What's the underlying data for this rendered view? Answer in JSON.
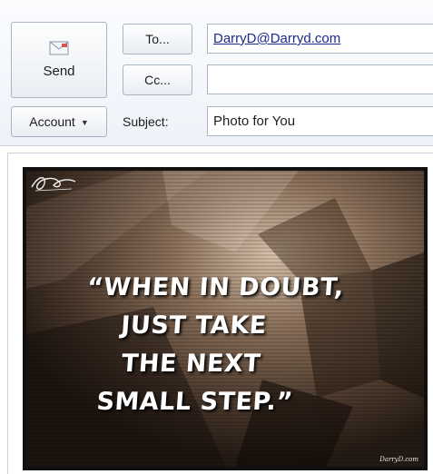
{
  "compose": {
    "send_label": "Send",
    "to_label": "To...",
    "cc_label": "Cc...",
    "account_label": "Account",
    "subject_label": "Subject:",
    "to_value": "DarryD@Darryd.com",
    "cc_value": "",
    "subject_value": "Photo for You"
  },
  "message": {
    "quote_lines": [
      "“WHEN IN DOUBT,",
      "JUST TAKE",
      "THE NEXT",
      "SMALL STEP.”"
    ],
    "signature_text": "DarryD.com"
  },
  "icons": {
    "send": "envelope-send-icon",
    "account_caret": "caret-down-icon"
  },
  "colors": {
    "link_blue": "#1b2a8c",
    "photo_bg": "#3e2f25",
    "quote_text": "#ffffff"
  }
}
